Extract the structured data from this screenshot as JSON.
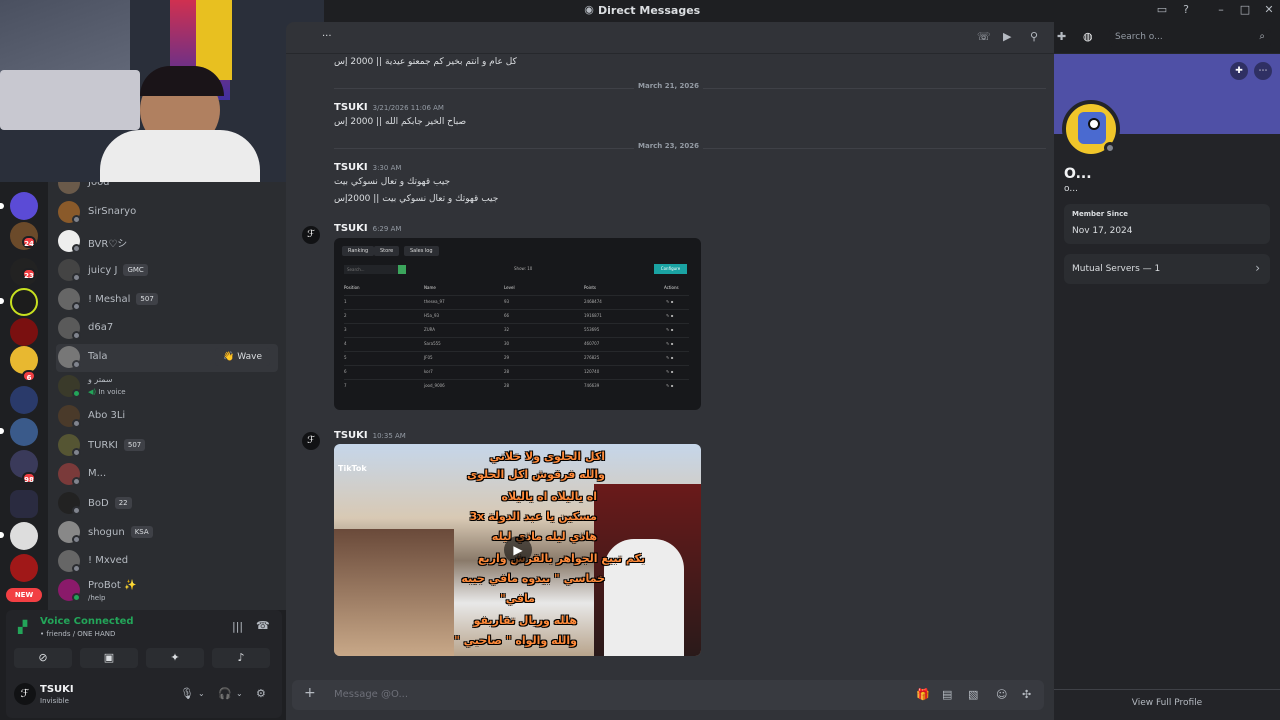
{
  "window": {
    "title": "Direct Messages"
  },
  "header": {
    "ellipsis": "...",
    "search_placeholder": "Search o..."
  },
  "rail": {
    "badges": [
      "24",
      "23",
      "6",
      "98"
    ],
    "new_label": "NEW"
  },
  "dms": [
    {
      "name": "Jood"
    },
    {
      "name": "SirSnaryo"
    },
    {
      "name": "BVR♡シ"
    },
    {
      "name": "juicy J",
      "tag": "GMC"
    },
    {
      "name": "! Meshal",
      "tag": "507"
    },
    {
      "name": "d6a7"
    },
    {
      "name": "Tala",
      "action": "👋 Wave"
    },
    {
      "name": "سمتر و",
      "sub": "In voice"
    },
    {
      "name": "Abo 3Li"
    },
    {
      "name": "TURKI",
      "tag": "507"
    },
    {
      "name": "M..."
    },
    {
      "name": "BoD",
      "tag": "22"
    },
    {
      "name": "shogun",
      "tag": "KSA"
    },
    {
      "name": "! Mxved"
    },
    {
      "name": "ProBot ✨",
      "sub": "/help"
    }
  ],
  "voice": {
    "status": "Voice Connected",
    "channel": "• friends / ONE HAND"
  },
  "user": {
    "name": "TSUKI",
    "status": "Invisible"
  },
  "messages": {
    "m0_text": "كل عام و انتم بخير كم جمعتو عيدية || 2000 إس",
    "date1": "March 21, 2026",
    "m1_author": "TSUKI",
    "m1_time": "3/21/2026 11:06 AM",
    "m1_text": "صباح الخير جابكم الله || 2000 إس",
    "date2": "March 23, 2026",
    "m2_author": "TSUKI",
    "m2_time": "3:30 AM",
    "m2_text1": "جيب قهوتك و تعال نسوكي بيت",
    "m2_text2": "جيب قهوتك و تعال نسوكي بيت || 2000إس",
    "m3_author": "TSUKI",
    "m3_time": "6:29 AM",
    "m4_author": "TSUKI",
    "m4_time": "10:35 AM"
  },
  "attachment_screenshot": {
    "tabs": [
      "Ranking",
      "Store",
      "Sales log"
    ],
    "search": "Search...",
    "show": "Show: 10",
    "configure": "Configure",
    "columns": [
      "Position",
      "Name",
      "Level",
      "Points",
      "Actions"
    ],
    "rows": [
      [
        "1",
        "thesea_97",
        "93",
        "2468474"
      ],
      [
        "2",
        "H5a_93",
        "66",
        "1916871"
      ],
      [
        "3",
        "ZURA",
        "32",
        "553695"
      ],
      [
        "4",
        "Sara555",
        "30",
        "460707"
      ],
      [
        "5",
        "JF05",
        "29",
        "276825"
      ],
      [
        "6",
        "kor7",
        "28",
        "120740"
      ],
      [
        "7",
        "jood_9006",
        "28",
        "746639"
      ]
    ]
  },
  "attachment_video": {
    "captions": [
      "اكل الحلوى ولا خلاني",
      "والله فرقوش اكل الحلوى",
      "اه ياليلاه اه ياليلاه",
      "مسكين يا عبد الدولة 3x",
      "هاذي ليله ماذي ليله",
      "بكم تبيع الجواهر بالقرش واربع",
      "خماسي \" بيدوه مافي جيبه",
      "مافي\"",
      "هلله وريال تقاربفو",
      "والله والواه \" صاحبي \""
    ],
    "watermark": "TikTok"
  },
  "input": {
    "placeholder": "Message @O..."
  },
  "profile": {
    "display_name": "O...",
    "username": "o...",
    "member_since_label": "Member Since",
    "member_since": "Nov 17, 2024",
    "mutual_servers": "Mutual Servers — 1",
    "view_full": "View Full Profile"
  },
  "colors": {
    "accent": "#5865f2",
    "online": "#23a559",
    "banner": "#4f50a6",
    "avatar": "#f0c62a",
    "danger": "#f23f43"
  }
}
